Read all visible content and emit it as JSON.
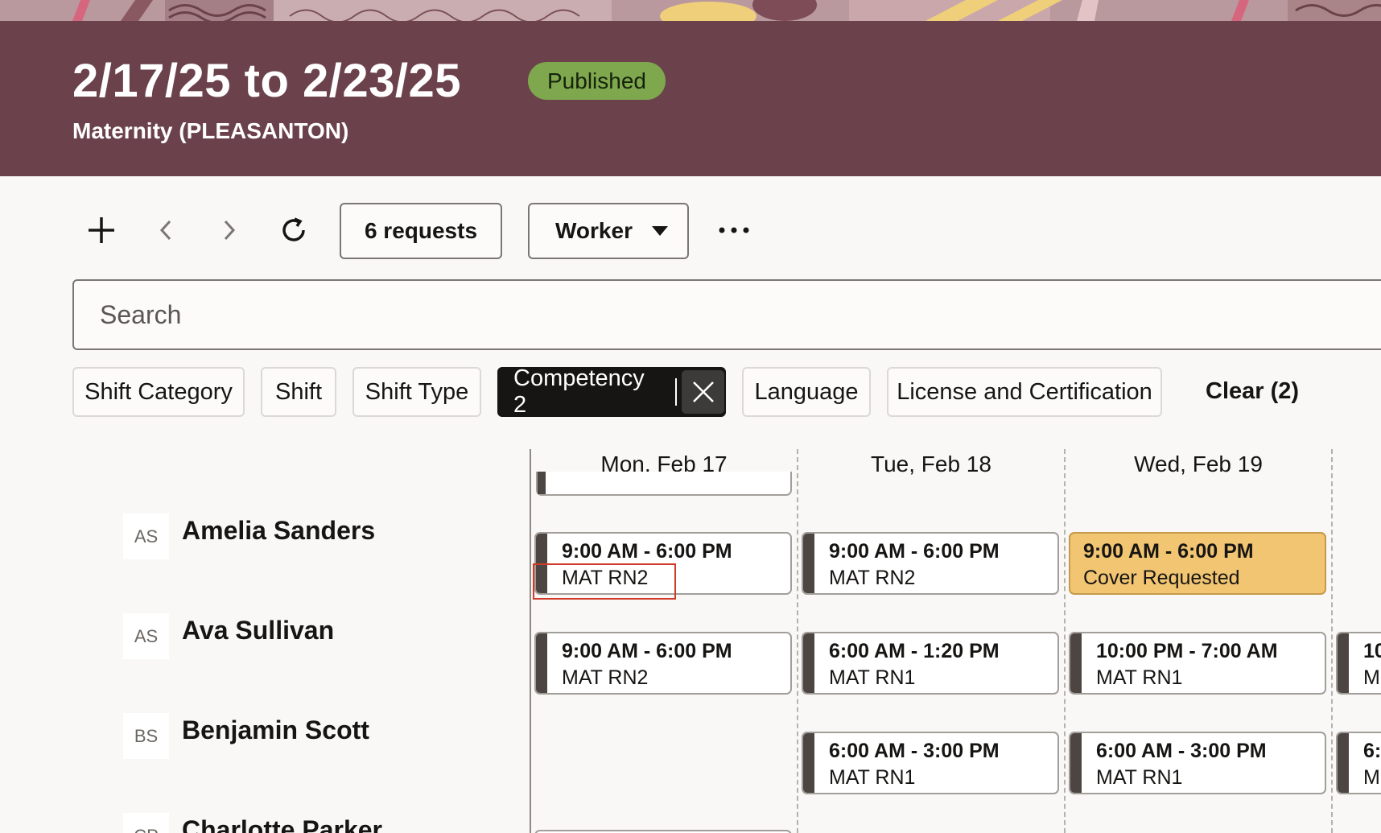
{
  "header": {
    "title": "2/17/25 to 2/23/25",
    "status": "Published",
    "subtitle": "Maternity (PLEASANTON)"
  },
  "toolbar": {
    "requests_label": "6 requests",
    "view_label": "Worker"
  },
  "search": {
    "placeholder": "Search"
  },
  "filters": {
    "shift_category": "Shift Category",
    "shift": "Shift",
    "shift_type": "Shift Type",
    "competency": "Competency 2",
    "language": "Language",
    "license": "License and Certification",
    "clear": "Clear (2)"
  },
  "days": [
    "Mon, Feb 17",
    "Tue, Feb 18",
    "Wed, Feb 19"
  ],
  "workers": [
    {
      "initials": "AS",
      "name": "Amelia Sanders",
      "shifts": [
        {
          "time": "9:00 AM - 6:00 PM",
          "label": "MAT RN2"
        },
        {
          "time": "9:00 AM - 6:00 PM",
          "label": "MAT RN2"
        },
        {
          "time": "9:00 AM - 6:00 PM",
          "label": "Cover Requested"
        }
      ]
    },
    {
      "initials": "AS",
      "name": "Ava Sullivan",
      "shifts": [
        {
          "time": "9:00 AM - 6:00 PM",
          "label": "MAT RN2"
        },
        {
          "time": "6:00 AM - 1:20 PM",
          "label": "MAT RN1"
        },
        {
          "time": "10:00 PM - 7:00 AM",
          "label": "MAT RN1"
        },
        {
          "time": "10",
          "label": "M"
        }
      ]
    },
    {
      "initials": "BS",
      "name": "Benjamin Scott",
      "shifts": [
        {
          "time": "6:00 AM - 3:00 PM",
          "label": "MAT RN1"
        },
        {
          "time": "6:00 AM - 3:00 PM",
          "label": "MAT RN1"
        },
        {
          "time": "6:",
          "label": "M"
        }
      ]
    },
    {
      "initials": "CP",
      "name": "Charlotte Parker"
    }
  ],
  "colors": {
    "header_bg": "#6b424b",
    "published_badge": "#7fa84e",
    "cover_requested": "#f2c572",
    "shift_accent": "#4c4542"
  },
  "icons": [
    "add-icon",
    "chevron-left-icon",
    "chevron-right-icon",
    "refresh-icon",
    "caret-down-icon",
    "more-icon",
    "close-icon"
  ]
}
